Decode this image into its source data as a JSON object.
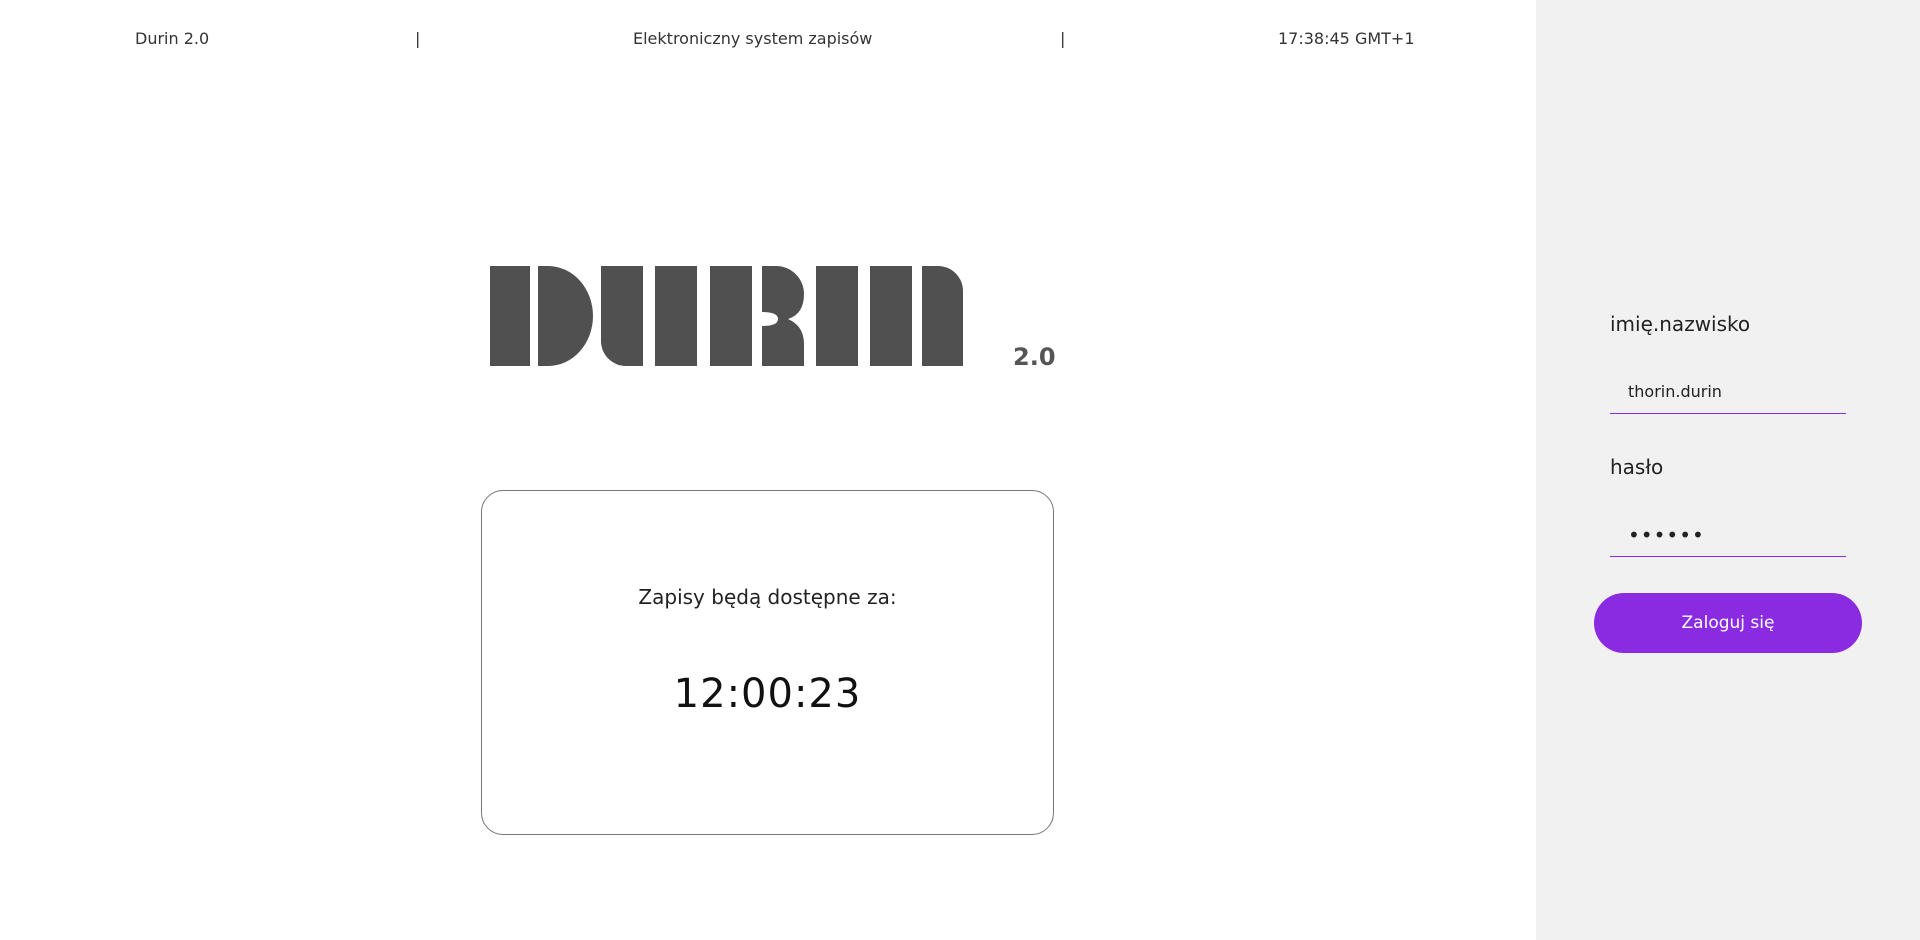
{
  "topbar": {
    "app_name": "Durin 2.0",
    "separator": "|",
    "subtitle": "Elektroniczny system zapisów",
    "clock": "17:38:45 GMT+1"
  },
  "logo": {
    "text": "Durin",
    "version": "2.0"
  },
  "countdown": {
    "label": "Zapisy będą dostępne za:",
    "timer": "12:00:23"
  },
  "login": {
    "username_label": "imię.nazwisko",
    "username_value": "thorin.durin",
    "password_label": "hasło",
    "password_value": "••••••",
    "submit_label": "Zaloguj się"
  },
  "colors": {
    "accent": "#8a2be2",
    "logo": "#505050",
    "sidebar_bg": "#f1f1f1"
  }
}
